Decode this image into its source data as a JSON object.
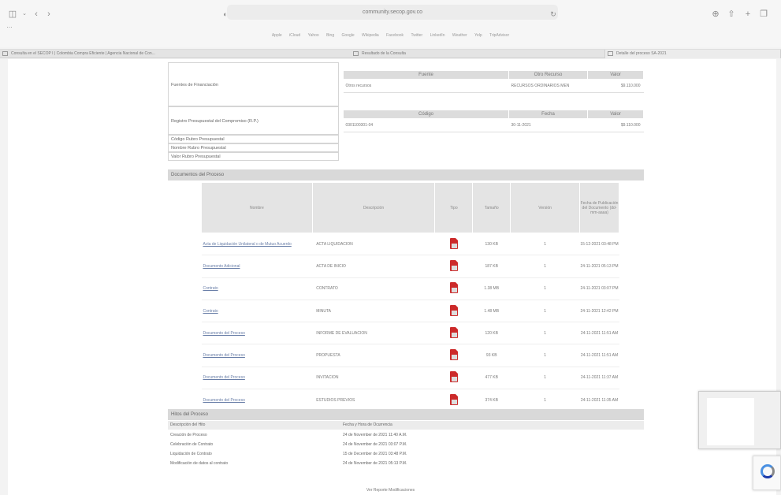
{
  "browser": {
    "url": "community.secop.gov.co",
    "favorites": [
      "Apple",
      "iCloud",
      "Yahoo",
      "Bing",
      "Google",
      "Wikipedia",
      "Facebook",
      "Twitter",
      "LinkedIn",
      "Weather",
      "Yelp",
      "TripAdvisor"
    ],
    "tabs": [
      {
        "label": "Consulta en el SECOP I | Colombia Compra Eficiente | Agencia Nacional de Con..."
      },
      {
        "label": "Resultado de la Consulta"
      },
      {
        "label": "Detalle del proceso SA-2021"
      }
    ],
    "icons": [
      "sidebar-icon",
      "back-icon",
      "forward-icon",
      "shield-icon",
      "lock-icon",
      "reload-icon",
      "download-icon",
      "share-icon",
      "new-tab-icon",
      "tab-overview-icon"
    ]
  },
  "funding": {
    "label": "Fuentes de Financiación",
    "headers": [
      "Fuente",
      "Otro Recurso",
      "Valor"
    ],
    "row": [
      "Otros recursos",
      "RECURSOS ORDINARIOS MEN",
      "$9.110.000"
    ]
  },
  "budget": {
    "label": "Registro Presupuestal del Compromiso (R.P.)",
    "headers": [
      "Código",
      "Fecha",
      "Valor"
    ],
    "row": [
      "0301100301-04",
      "30-11-2021",
      "$9.110.000"
    ]
  },
  "extra_rows": [
    "Código Rubro Presupuestal",
    "Nombre Rubro Presupuestal",
    "Valor Rubro Presupuestal"
  ],
  "docs_section": {
    "title": "Documentos del Proceso",
    "headers": [
      "Nombre",
      "Descripción",
      "Tipo",
      "Tamaño",
      "Versión",
      "Fecha de Publicación del Documento (dd-mm-aaaa)"
    ],
    "rows": [
      {
        "name": "Acta de Liquidación Unilateral o de Mutuo Acuerdo",
        "desc": "ACTA LIQUIDACION",
        "size": "130 KB",
        "version": "1",
        "date": "15-12-2021 03:48 PM"
      },
      {
        "name": "Documento Adicional",
        "desc": "ACTA DE INICIO",
        "size": "187 KB",
        "version": "1",
        "date": "24-11-2021 05:13 PM"
      },
      {
        "name": "Contrato",
        "desc": "CONTRATO",
        "size": "1.38 MB",
        "version": "1",
        "date": "24-11-2021 03:07 PM"
      },
      {
        "name": "Contrato",
        "desc": "MINUTA",
        "size": "1.48 MB",
        "version": "1",
        "date": "24-11-2021 12:42 PM"
      },
      {
        "name": "Documento del Proceso",
        "desc": "INFORME DE EVALUACION",
        "size": "120 KB",
        "version": "1",
        "date": "24-11-2021 11:51 AM"
      },
      {
        "name": "Documento del Proceso",
        "desc": "PROPUESTA",
        "size": "93 KB",
        "version": "1",
        "date": "24-11-2021 11:51 AM"
      },
      {
        "name": "Documento del Proceso",
        "desc": "INVITACION",
        "size": "477 KB",
        "version": "1",
        "date": "24-11-2021 11:37 AM"
      },
      {
        "name": "Documento del Proceso",
        "desc": "ESTUDIOS PREVIOS",
        "size": "374 KB",
        "version": "1",
        "date": "24-11-2021 11:35 AM"
      }
    ]
  },
  "hitos": {
    "title": "Hitos del Proceso",
    "headers": [
      "Descripción del Hito",
      "Fecha y Hora de Ocurrencia"
    ],
    "rows": [
      [
        "Creación de Proceso",
        "24 de November de 2021 11:40 A.M."
      ],
      [
        "Celebración de Contrato",
        "24 de November de 2021 03:07 P.M."
      ],
      [
        "Liquidación de Contrato",
        "15 de December de 2021 03:48 P.M."
      ],
      [
        "Modificación de datos al contrato",
        "24 de November de 2021 05:13 P.M."
      ]
    ]
  },
  "footer_link": "Ver Reporte Modificaciones"
}
